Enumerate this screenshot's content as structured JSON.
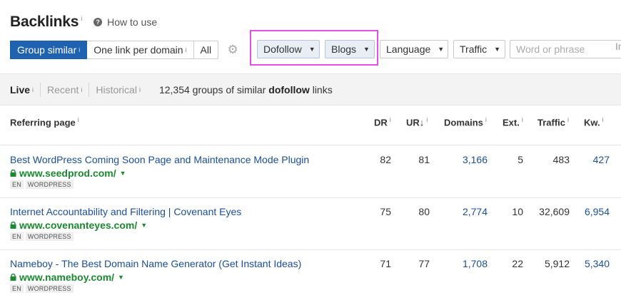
{
  "header": {
    "title": "Backlinks",
    "title_info": "i",
    "howto_icon": "question-circle-icon",
    "howto_label": "How to use"
  },
  "toolbar": {
    "segments": [
      {
        "label": "Group similar",
        "info": "i",
        "active": true
      },
      {
        "label": "One link per domain",
        "info": "i",
        "active": false
      },
      {
        "label": "All",
        "info": "",
        "active": false
      }
    ],
    "settings_icon": "gear-icon",
    "filters": {
      "dofollow": "Dofollow",
      "blogs": "Blogs",
      "language": "Language",
      "traffic": "Traffic"
    },
    "search_placeholder": "Word or phrase",
    "search_overflow": "In",
    "highlight_color": "#e54fe5",
    "accent_color": "#1f63b0"
  },
  "infobar": {
    "modes": [
      {
        "label": "Live",
        "info": "i",
        "active": true
      },
      {
        "label": "Recent",
        "info": "i",
        "active": false
      },
      {
        "label": "Historical",
        "info": "i",
        "active": false
      }
    ],
    "summary_prefix": "12,354 groups of similar",
    "summary_bold": "dofollow",
    "summary_suffix": "links"
  },
  "table": {
    "columns": {
      "referring_page": "Referring page",
      "dr": "DR",
      "ur": "UR",
      "ur_sort": "↓",
      "domains": "Domains",
      "ext": "Ext.",
      "traffic": "Traffic",
      "kw": "Kw.",
      "info": "i"
    },
    "rows": [
      {
        "title": "Best WordPress Coming Soon Page and Maintenance Mode Plugin",
        "domain": "www.seedprod.com/",
        "tags": [
          "EN",
          "WORDPRESS"
        ],
        "dr": "82",
        "ur": "81",
        "domains": "3,166",
        "ext": "5",
        "traffic": "483",
        "kw": "427"
      },
      {
        "title": "Internet Accountability and Filtering | Covenant Eyes",
        "domain": "www.covenanteyes.com/",
        "tags": [
          "EN",
          "WORDPRESS"
        ],
        "dr": "75",
        "ur": "80",
        "domains": "2,774",
        "ext": "10",
        "traffic": "32,609",
        "kw": "6,954"
      },
      {
        "title": "Nameboy - The Best Domain Name Generator (Get Instant Ideas)",
        "domain": "www.nameboy.com/",
        "tags": [
          "EN",
          "WORDPRESS"
        ],
        "dr": "71",
        "ur": "77",
        "domains": "1,708",
        "ext": "22",
        "traffic": "5,912",
        "kw": "5,340"
      }
    ]
  }
}
